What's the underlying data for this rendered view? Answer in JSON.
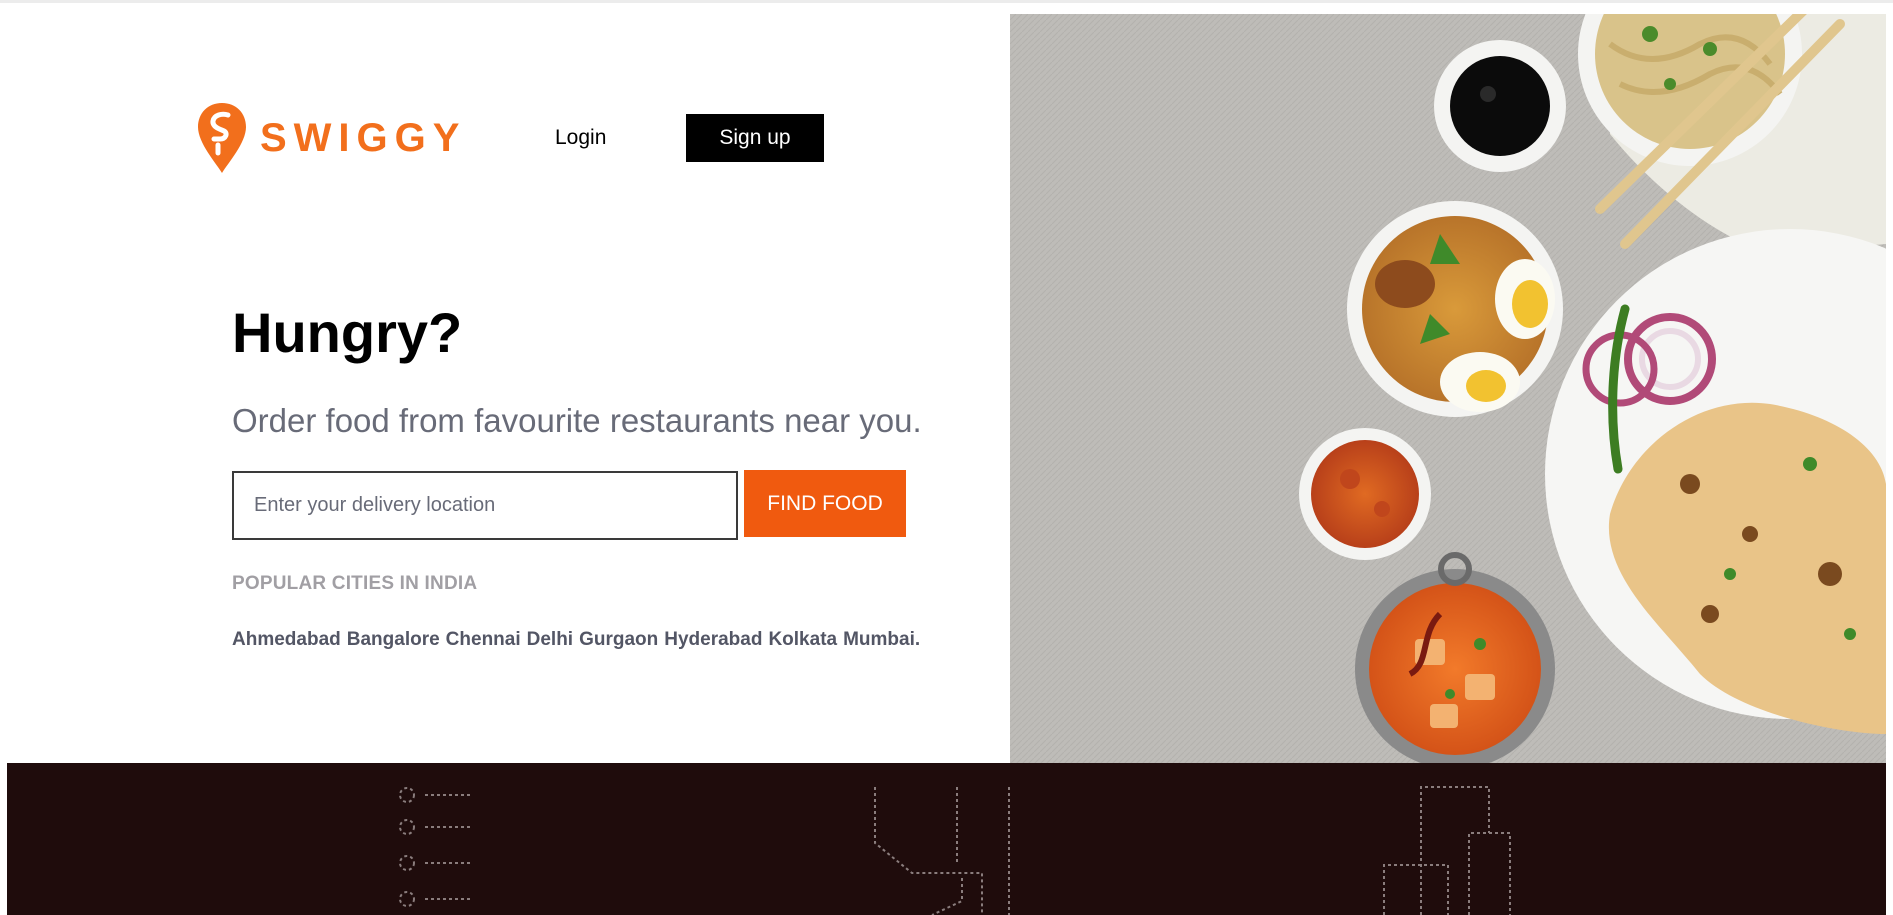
{
  "brand": {
    "name": "SWIGGY",
    "color": "#f26f1c",
    "icon": "swiggy-pin-logo-icon"
  },
  "nav": {
    "login_label": "Login",
    "signup_label": "Sign up"
  },
  "hero": {
    "title": "Hungry?",
    "subtitle": "Order food from favourite restaurants near you.",
    "search_placeholder": "Enter your delivery location",
    "find_label": "FIND FOOD",
    "accent_color": "#f05a0f"
  },
  "popular": {
    "title": "POPULAR CITIES IN INDIA",
    "cities": [
      "Ahmedabad",
      "Bangalore",
      "Chennai",
      "Delhi",
      "Gurgaon",
      "Hyderabad",
      "Kolkata",
      "Mumbai."
    ]
  },
  "footer": {
    "background": "#1f0c0c",
    "icons": [
      "dotted-list-icon",
      "dotted-path-icon",
      "dotted-buildings-icon"
    ]
  }
}
